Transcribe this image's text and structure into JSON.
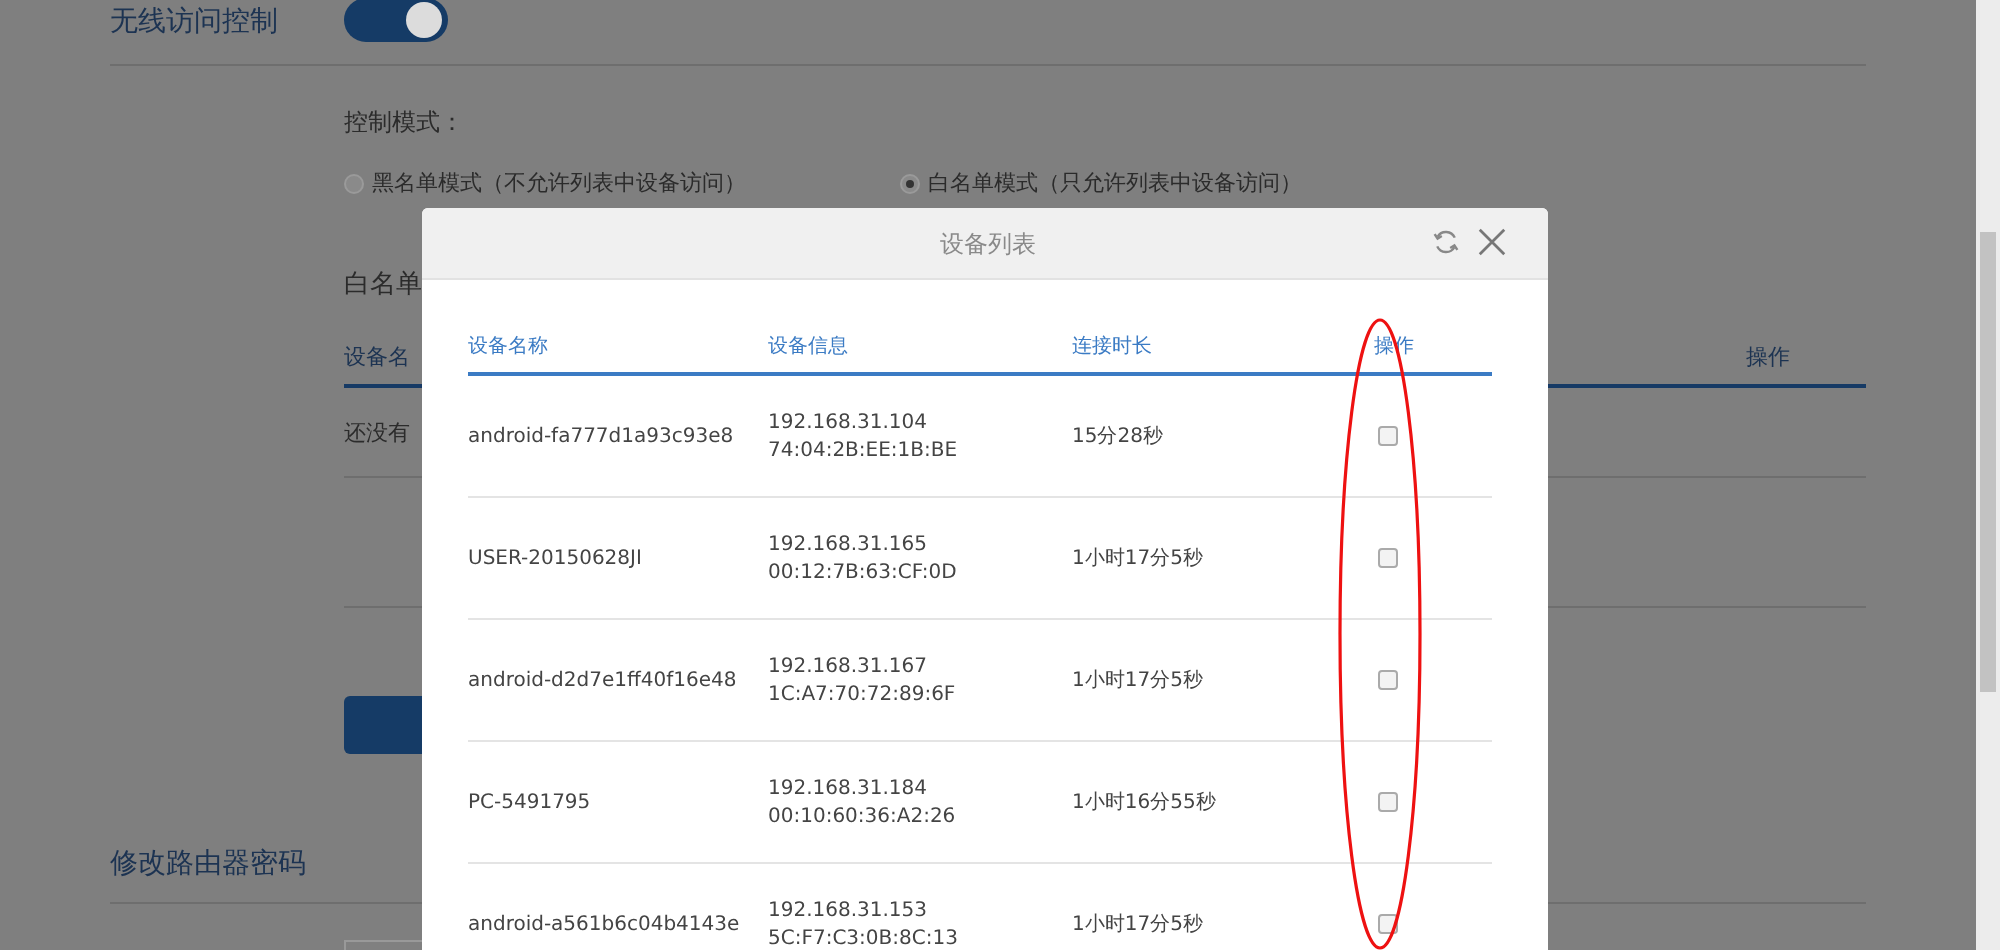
{
  "page": {
    "wireless_access_control": {
      "label": "无线访问控制",
      "on": true
    },
    "mode_label": "控制模式：",
    "modes": [
      {
        "label": "黑名单模式（不允许列表中设备访问）",
        "selected": false
      },
      {
        "label": "白名单模式（只允许列表中设备访问）",
        "selected": true
      }
    ],
    "whitelist_title": "白名单",
    "whitelist_columns": [
      "设备名",
      "操作"
    ],
    "whitelist_empty": "还没有",
    "password_section": "修改路由器密码"
  },
  "dialog": {
    "title": "设备列表",
    "columns": [
      "设备名称",
      "设备信息",
      "连接时长",
      "操作"
    ],
    "rows": [
      {
        "name": "android-fa777d1a93c93e8",
        "ip": "192.168.31.104",
        "mac": "74:04:2B:EE:1B:BE",
        "duration": "15分28秒",
        "checked": false
      },
      {
        "name": "USER-20150628JI",
        "ip": "192.168.31.165",
        "mac": "00:12:7B:63:CF:0D",
        "duration": "1小时17分5秒",
        "checked": false
      },
      {
        "name": "android-d2d7e1ff40f16e48",
        "ip": "192.168.31.167",
        "mac": "1C:A7:70:72:89:6F",
        "duration": "1小时17分5秒",
        "checked": false
      },
      {
        "name": "PC-5491795",
        "ip": "192.168.31.184",
        "mac": "00:10:60:36:A2:26",
        "duration": "1小时16分55秒",
        "checked": false
      },
      {
        "name": "android-a561b6c04b4143e",
        "ip": "192.168.31.153",
        "mac": "5C:F7:C3:0B:8C:13",
        "duration": "1小时17分5秒",
        "checked": false
      }
    ]
  }
}
